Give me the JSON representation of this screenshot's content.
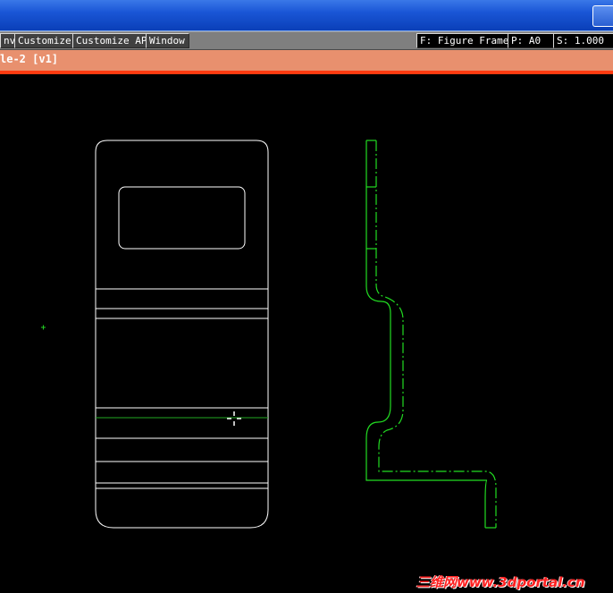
{
  "toolbar": {
    "menu_items": [
      "nv",
      "Customize",
      "Customize AP",
      "Window"
    ],
    "status": {
      "figure_frame": "F: Figure Frame",
      "paper": "P: A0",
      "scale": "S: 1.000"
    }
  },
  "viewport": {
    "title": "le-2 [v1]"
  },
  "colors": {
    "titlebar": "#1a56d6",
    "viewport_title_bg": "#e8906e",
    "viewport_title_border": "#ff3b10",
    "geometry_white": "#ffffff",
    "geometry_green": "#22dd22",
    "background": "#000000"
  },
  "icons": {
    "cursor": "crosshair-cursor-icon",
    "origin": "origin-marker-icon"
  },
  "watermark": {
    "text": "三维网www.3dportal.cn"
  }
}
